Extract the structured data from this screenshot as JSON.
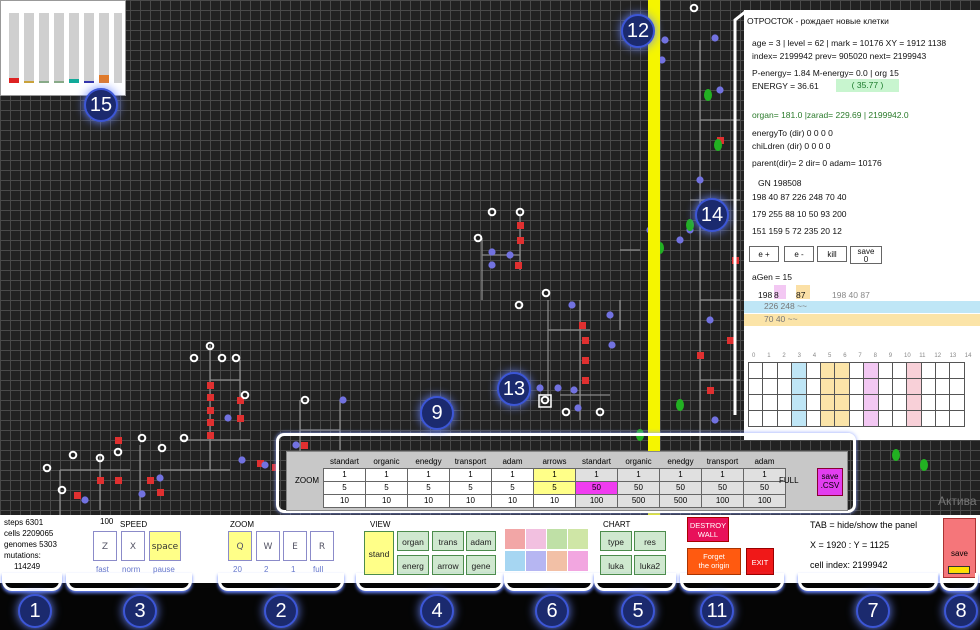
{
  "info": {
    "title": "ОТРОСТОК - рождает новые клетки",
    "line1": "age = 3  |  level = 62  |  mark = 10176          XY = 1912   1138",
    "line2": "index= 2199942     prev= 905020     next= 2199943",
    "line3": "P-energy= 1.84    M-energy= 0.0        | org  15",
    "line4": "ENERGY = 36.61",
    "energy_box": "( 35.77 )",
    "organ": "organ= 181.0  |zarad= 229.69        |      2199942.0",
    "energyto": "energyTo (dir)        0  0  0  0",
    "children": "chiLdren (dir)         0  0  0  0",
    "parent": "parent(dir)= 2    dir= 0      adam= 10176",
    "gn": "GN 198508",
    "gn_rows": [
      "198     40      87      226     248     70      40",
      "179    255     88      10      50      93     200",
      "151    159      5      72     235      20      12"
    ],
    "btn_e_plus": "e +",
    "btn_e_minus": "e -",
    "btn_kill": "kill",
    "btn_save0": "save\n0",
    "agen": "aGen = 15",
    "agen_row1a": "198",
    "agen_row1b": "8",
    "agen_row1c": "87",
    "agen_row1d": "198      40      87",
    "agen_row2": "226    248      ~~",
    "agen_row3": "70      40       ~~",
    "ticks": [
      "0",
      "1",
      "2",
      "3",
      "4",
      "5",
      "6",
      "7",
      "8",
      "9",
      "10",
      "11",
      "12",
      "13",
      "14"
    ]
  },
  "cfg": {
    "zoom": "ZOOM",
    "full": "FULL",
    "save": "save\n.CSV",
    "headers": [
      "standart",
      "organic",
      "enedgy",
      "transport",
      "adam",
      "arrows",
      "standart",
      "organic",
      "enedgy",
      "transport",
      "adam"
    ],
    "rows": [
      [
        "1",
        "1",
        "1",
        "1",
        "1",
        "1",
        "1",
        "1",
        "1",
        "1",
        "1"
      ],
      [
        "5",
        "5",
        "5",
        "5",
        "5",
        "5",
        "50",
        "50",
        "50",
        "50",
        "50"
      ],
      [
        "10",
        "10",
        "10",
        "10",
        "10",
        "10",
        "100",
        "500",
        "500",
        "100",
        "100"
      ]
    ]
  },
  "stats": {
    "steps": "steps   6301",
    "cells": "cells   2209065",
    "genomes": "genomes  5303",
    "mutations": "mutations:",
    "mut_val": "114249"
  },
  "speed": {
    "label": "SPEED",
    "num": "100",
    "keys": [
      "Z",
      "X",
      "space"
    ],
    "sub": [
      "fast",
      "norm",
      "pause"
    ]
  },
  "zoom": {
    "label": "ZOOM",
    "keys": [
      "Q",
      "W",
      "E",
      "R"
    ],
    "sub": [
      "20",
      "2",
      "1",
      "full"
    ]
  },
  "view": {
    "label": "VIEW",
    "stand": "stand",
    "organ": "organ",
    "trans": "trans",
    "adam": "adam",
    "energ": "energ",
    "arrow": "arrow",
    "gene": "gene"
  },
  "chart": {
    "label": "CHART",
    "type": "type",
    "res": "res",
    "luka": "luka",
    "luka2": "luka2"
  },
  "actions": {
    "destroy": "DESTROY\nWALL",
    "forget": "Forget\nthe origin",
    "exit": "EXIT"
  },
  "status": {
    "tab": "TAB = hide/show the panel",
    "xy": "X = 1920  :  Y = 1125",
    "cell": "cell index: 2199942"
  },
  "save_btn": "save",
  "watermark": "Актива",
  "badges": [
    "1",
    "2",
    "3",
    "4",
    "5",
    "6",
    "7",
    "8",
    "9",
    "11",
    "12",
    "13",
    "14",
    "15"
  ],
  "colors": {
    "yellow_line": "#f5f500",
    "badge": "#1b2a6e",
    "red_cell": "#e03030",
    "blue_cell": "#7272e0",
    "green_cell": "#22b022"
  }
}
